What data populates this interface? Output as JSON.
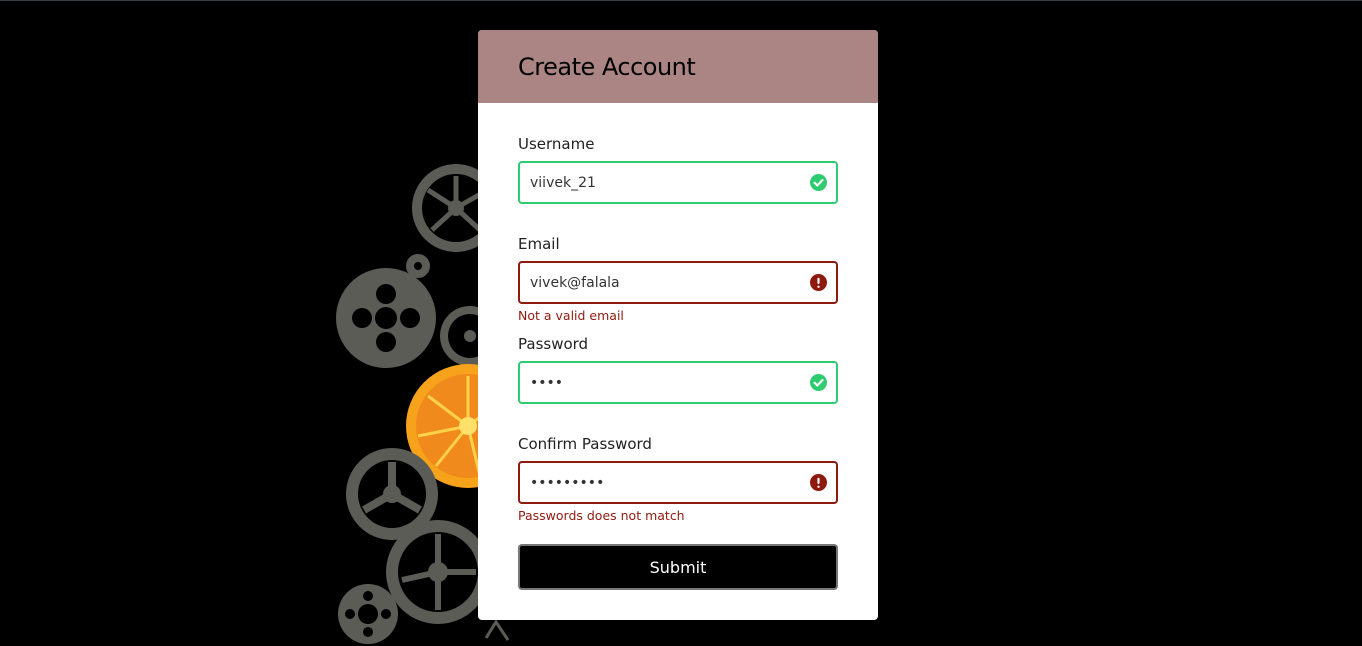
{
  "form": {
    "title": "Create Account",
    "username": {
      "label": "Username",
      "value": "viivek_21",
      "status": "valid"
    },
    "email": {
      "label": "Email",
      "value": "vivek@falala",
      "status": "invalid",
      "error": "Not a valid email"
    },
    "password": {
      "label": "Password",
      "value": "••••",
      "status": "valid"
    },
    "confirm_password": {
      "label": "Confirm Password",
      "value": "•••••••••",
      "status": "invalid",
      "error": "Passwords does not match"
    },
    "submit_label": "Submit"
  },
  "colors": {
    "header": "#ab8583",
    "valid": "#2ecc71",
    "invalid": "#8e1a0e",
    "background": "#000000"
  },
  "icons": {
    "valid": "check-circle-icon",
    "invalid": "exclamation-circle-icon",
    "decoration": "gears-illustration"
  }
}
